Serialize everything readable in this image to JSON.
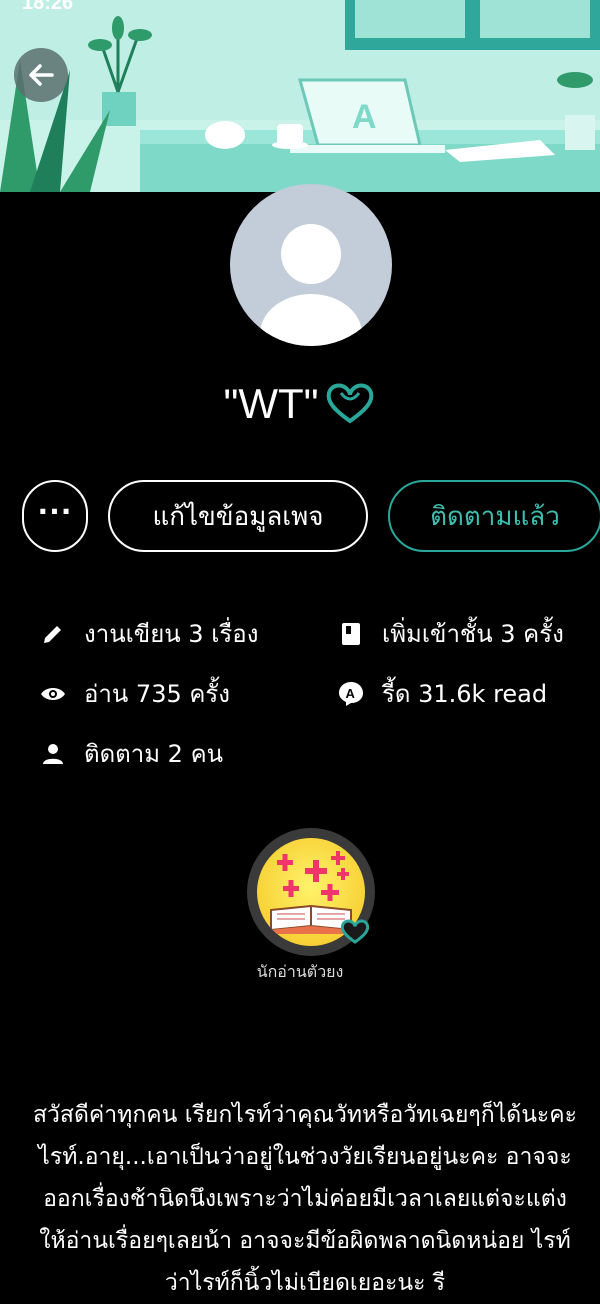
{
  "status_bar": {
    "time": "18:26"
  },
  "profile": {
    "name": "\"WT\"",
    "buttons": {
      "more": "···",
      "edit": "แก้ไขข้อมูลเพจ",
      "follow": "ติดตามแล้ว"
    }
  },
  "stats": {
    "written": "งานเขียน 3 เรื่อง",
    "shelved": "เพิ่มเข้าชั้น 3 ครั้ง",
    "reads": "อ่าน 735 ครั้ง",
    "read_count": "รี้ด 31.6k read",
    "following": "ติดตาม 2 คน"
  },
  "badge": {
    "label": "นักอ่านตัวยง"
  },
  "bio": "สวัสดีค่าทุกคน เรียกไรท์ว่าคุณวัทหรือวัทเฉยๆก็ได้นะคะไรท์.อายุ...เอาเป็นว่าอยู่ในช่วงวัยเรียนอยู่นะคะ อาจจะออกเรื่องช้านิดนึงเพราะว่าไม่ค่อยมีเวลาเลยแต่จะแต่งให้อ่านเรื่อยๆเลยน้า อาจจะมีข้อผิดพลาดนิดหน่อย ไรท์ว่าไรท์ก็นิ้วไม่เบียดเยอะนะ รี",
  "colors": {
    "accent": "#2aa79b",
    "background": "#000000",
    "banner": "#bdeee3"
  },
  "icons": [
    "back-arrow-icon",
    "pencil-icon",
    "book-icon",
    "eye-icon",
    "read-icon",
    "person-icon",
    "heart-icon"
  ]
}
